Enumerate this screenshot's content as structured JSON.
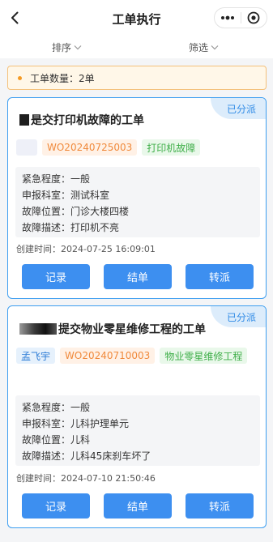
{
  "header": {
    "title": "工单执行"
  },
  "filters": {
    "sort_label": "排序",
    "filter_label": "筛选"
  },
  "summary": {
    "count_text": "工单数量：2单"
  },
  "orders": [
    {
      "status": "已分派",
      "title": "是交打印机故障的工单",
      "order_no": "WO20240725003",
      "category": "打印机故障",
      "urgency": "紧急程度：一般",
      "department": "申报科室：测试科室",
      "location": "故障位置：门诊大楼四楼",
      "description": "故障描述：打印机不亮",
      "created": "创建时间：2024-07-25 16:09:01",
      "actions": [
        "记录",
        "结单",
        "转派"
      ]
    },
    {
      "status": "已分派",
      "title": "提交物业零星维修工程的工单",
      "assignee": "孟飞宇",
      "order_no": "WO20240710003",
      "category": "物业零星维修工程",
      "urgency": "紧急程度：一般",
      "department": "申报科室：儿科护理单元",
      "location": "故障位置：儿科",
      "description": "故障描述：儿科45床刹车坏了",
      "created": "创建时间：2024-07-10 21:50:46",
      "actions": [
        "记录",
        "结单",
        "转派"
      ]
    }
  ],
  "colors": {
    "primary": "#3d8ff0",
    "card_border": "#3d9ef0",
    "warning_bg": "#fff7e8",
    "warning_border": "#f4c07a",
    "tag_green": "#3fae49",
    "tag_orange": "#f08a3c"
  }
}
